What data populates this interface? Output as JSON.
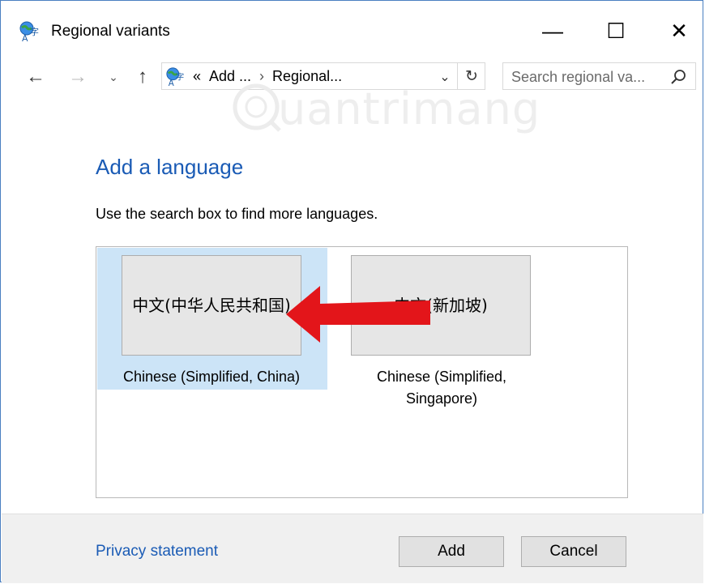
{
  "window": {
    "title": "Regional variants",
    "icon": "language-globe-icon",
    "controls": {
      "minimize": "—",
      "maximize": "☐",
      "close": "✕"
    }
  },
  "nav": {
    "back": "←",
    "forward": "→",
    "recent": "⌄",
    "up": "↑",
    "address": {
      "overflow": "«",
      "crumbs": [
        "Add ...",
        "Regional..."
      ],
      "separator": "›",
      "dropdown": "⌄",
      "refresh": "↻"
    },
    "search": {
      "placeholder": "Search regional va...",
      "value": ""
    }
  },
  "watermark": {
    "text": "uantrimang"
  },
  "main": {
    "heading": "Add a language",
    "hint": "Use the search box to find more languages.",
    "languages": [
      {
        "native": "中文(中华人民共和国)",
        "label": "Chinese (Simplified, China)",
        "selected": true
      },
      {
        "native": "中文(新加坡)",
        "label": "Chinese (Simplified, Singapore)",
        "selected": false
      }
    ]
  },
  "annotation": {
    "type": "arrow",
    "color": "#e3151a",
    "points_to": "中文(中华人民共和国)"
  },
  "footer": {
    "privacy": "Privacy statement",
    "add": "Add",
    "cancel": "Cancel"
  },
  "colors": {
    "accent": "#1a5bb5",
    "selection": "#cce4f7",
    "arrow": "#e3151a",
    "border": "#4a7fc1"
  }
}
